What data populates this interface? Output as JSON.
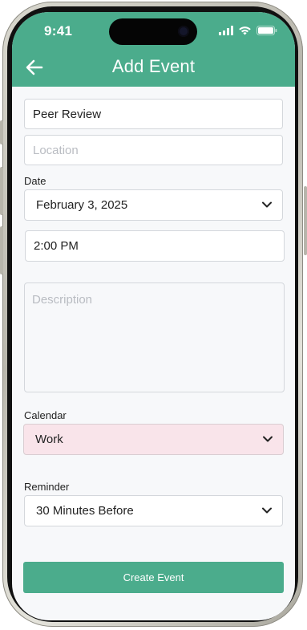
{
  "status": {
    "time": "9:41"
  },
  "header": {
    "title": "Add Event",
    "back_icon": "arrow-left-icon"
  },
  "form": {
    "title_value": "Peer Review",
    "location_placeholder": "Location",
    "date_label": "Date",
    "date_value": "February 3, 2025",
    "time_value": "2:00 PM",
    "description_placeholder": "Description",
    "calendar_label": "Calendar",
    "calendar_value": "Work",
    "reminder_label": "Reminder",
    "reminder_value": "30 Minutes Before"
  },
  "actions": {
    "create_label": "Create Event"
  },
  "colors": {
    "accent": "#4bac8c",
    "calendar_bg": "#f9e4ea"
  }
}
